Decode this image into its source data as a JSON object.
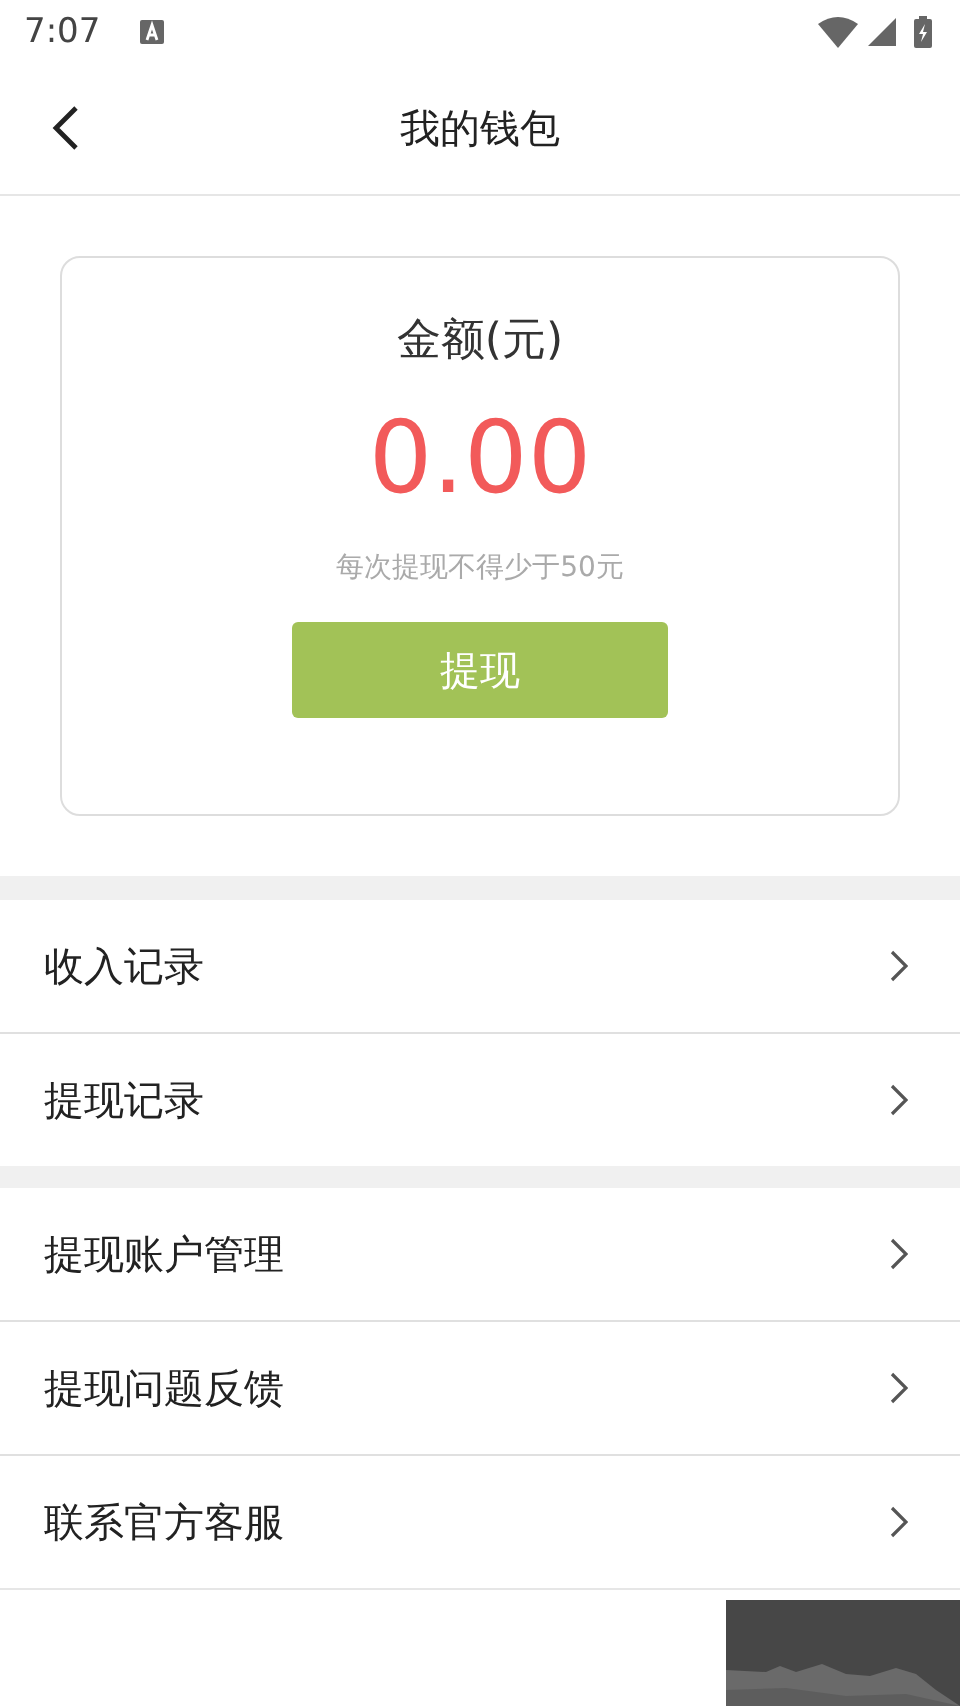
{
  "status_bar": {
    "time": "7:07"
  },
  "header": {
    "title": "我的钱包"
  },
  "wallet": {
    "label": "金额(元)",
    "amount": "0.00",
    "note": "每次提现不得少于50元",
    "button": "提现"
  },
  "menu_groups": [
    {
      "items": [
        {
          "label": "收入记录"
        },
        {
          "label": "提现记录"
        }
      ]
    },
    {
      "items": [
        {
          "label": "提现账户管理"
        },
        {
          "label": "提现问题反馈"
        },
        {
          "label": "联系官方客服"
        }
      ]
    }
  ]
}
